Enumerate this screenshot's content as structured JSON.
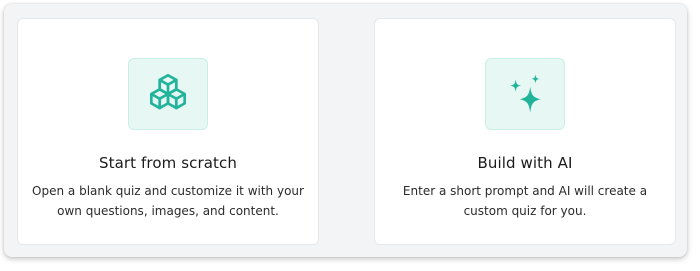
{
  "options": [
    {
      "title": "Start from scratch",
      "description": "Open a blank quiz and customize it with your own questions, images, and content.",
      "icon": "cubes-icon"
    },
    {
      "title": "Build with AI",
      "description": "Enter a short prompt and AI will create a custom quiz for you.",
      "icon": "sparkles-icon"
    }
  ],
  "colors": {
    "accent": "#22b49a",
    "icon_bg": "#e7f8f4",
    "panel_bg": "#f3f4f6",
    "card_bg": "#ffffff"
  }
}
